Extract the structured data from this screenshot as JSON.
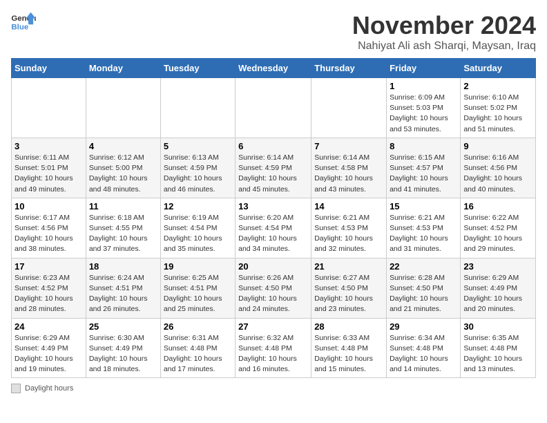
{
  "logo": {
    "general": "General",
    "blue": "Blue"
  },
  "title": "November 2024",
  "location": "Nahiyat Ali ash Sharqi, Maysan, Iraq",
  "weekdays": [
    "Sunday",
    "Monday",
    "Tuesday",
    "Wednesday",
    "Thursday",
    "Friday",
    "Saturday"
  ],
  "weeks": [
    [
      {
        "day": "",
        "info": ""
      },
      {
        "day": "",
        "info": ""
      },
      {
        "day": "",
        "info": ""
      },
      {
        "day": "",
        "info": ""
      },
      {
        "day": "",
        "info": ""
      },
      {
        "day": "1",
        "info": "Sunrise: 6:09 AM\nSunset: 5:03 PM\nDaylight: 10 hours and 53 minutes."
      },
      {
        "day": "2",
        "info": "Sunrise: 6:10 AM\nSunset: 5:02 PM\nDaylight: 10 hours and 51 minutes."
      }
    ],
    [
      {
        "day": "3",
        "info": "Sunrise: 6:11 AM\nSunset: 5:01 PM\nDaylight: 10 hours and 49 minutes."
      },
      {
        "day": "4",
        "info": "Sunrise: 6:12 AM\nSunset: 5:00 PM\nDaylight: 10 hours and 48 minutes."
      },
      {
        "day": "5",
        "info": "Sunrise: 6:13 AM\nSunset: 4:59 PM\nDaylight: 10 hours and 46 minutes."
      },
      {
        "day": "6",
        "info": "Sunrise: 6:14 AM\nSunset: 4:59 PM\nDaylight: 10 hours and 45 minutes."
      },
      {
        "day": "7",
        "info": "Sunrise: 6:14 AM\nSunset: 4:58 PM\nDaylight: 10 hours and 43 minutes."
      },
      {
        "day": "8",
        "info": "Sunrise: 6:15 AM\nSunset: 4:57 PM\nDaylight: 10 hours and 41 minutes."
      },
      {
        "day": "9",
        "info": "Sunrise: 6:16 AM\nSunset: 4:56 PM\nDaylight: 10 hours and 40 minutes."
      }
    ],
    [
      {
        "day": "10",
        "info": "Sunrise: 6:17 AM\nSunset: 4:56 PM\nDaylight: 10 hours and 38 minutes."
      },
      {
        "day": "11",
        "info": "Sunrise: 6:18 AM\nSunset: 4:55 PM\nDaylight: 10 hours and 37 minutes."
      },
      {
        "day": "12",
        "info": "Sunrise: 6:19 AM\nSunset: 4:54 PM\nDaylight: 10 hours and 35 minutes."
      },
      {
        "day": "13",
        "info": "Sunrise: 6:20 AM\nSunset: 4:54 PM\nDaylight: 10 hours and 34 minutes."
      },
      {
        "day": "14",
        "info": "Sunrise: 6:21 AM\nSunset: 4:53 PM\nDaylight: 10 hours and 32 minutes."
      },
      {
        "day": "15",
        "info": "Sunrise: 6:21 AM\nSunset: 4:53 PM\nDaylight: 10 hours and 31 minutes."
      },
      {
        "day": "16",
        "info": "Sunrise: 6:22 AM\nSunset: 4:52 PM\nDaylight: 10 hours and 29 minutes."
      }
    ],
    [
      {
        "day": "17",
        "info": "Sunrise: 6:23 AM\nSunset: 4:52 PM\nDaylight: 10 hours and 28 minutes."
      },
      {
        "day": "18",
        "info": "Sunrise: 6:24 AM\nSunset: 4:51 PM\nDaylight: 10 hours and 26 minutes."
      },
      {
        "day": "19",
        "info": "Sunrise: 6:25 AM\nSunset: 4:51 PM\nDaylight: 10 hours and 25 minutes."
      },
      {
        "day": "20",
        "info": "Sunrise: 6:26 AM\nSunset: 4:50 PM\nDaylight: 10 hours and 24 minutes."
      },
      {
        "day": "21",
        "info": "Sunrise: 6:27 AM\nSunset: 4:50 PM\nDaylight: 10 hours and 23 minutes."
      },
      {
        "day": "22",
        "info": "Sunrise: 6:28 AM\nSunset: 4:50 PM\nDaylight: 10 hours and 21 minutes."
      },
      {
        "day": "23",
        "info": "Sunrise: 6:29 AM\nSunset: 4:49 PM\nDaylight: 10 hours and 20 minutes."
      }
    ],
    [
      {
        "day": "24",
        "info": "Sunrise: 6:29 AM\nSunset: 4:49 PM\nDaylight: 10 hours and 19 minutes."
      },
      {
        "day": "25",
        "info": "Sunrise: 6:30 AM\nSunset: 4:49 PM\nDaylight: 10 hours and 18 minutes."
      },
      {
        "day": "26",
        "info": "Sunrise: 6:31 AM\nSunset: 4:48 PM\nDaylight: 10 hours and 17 minutes."
      },
      {
        "day": "27",
        "info": "Sunrise: 6:32 AM\nSunset: 4:48 PM\nDaylight: 10 hours and 16 minutes."
      },
      {
        "day": "28",
        "info": "Sunrise: 6:33 AM\nSunset: 4:48 PM\nDaylight: 10 hours and 15 minutes."
      },
      {
        "day": "29",
        "info": "Sunrise: 6:34 AM\nSunset: 4:48 PM\nDaylight: 10 hours and 14 minutes."
      },
      {
        "day": "30",
        "info": "Sunrise: 6:35 AM\nSunset: 4:48 PM\nDaylight: 10 hours and 13 minutes."
      }
    ]
  ],
  "legend_label": "Daylight hours"
}
